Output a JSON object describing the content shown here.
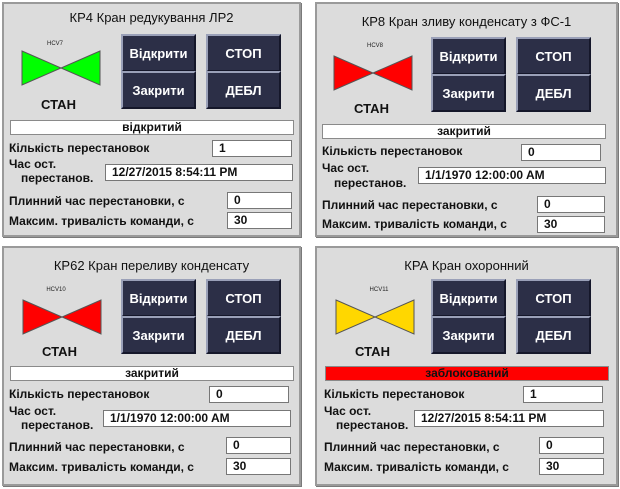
{
  "panels": [
    {
      "title": "КР4 Кран редукування ЛР2",
      "tag": "HCV7",
      "valve_color": "#00ff00",
      "state_label": "СТАН",
      "open_label": "Відкрити",
      "close_label": "Закрити",
      "stop_label": "СТОП",
      "deblock_label": "ДЕБЛ",
      "status": "відкритий",
      "status_color": "#ffffff",
      "count_label": "Кількість перестановок",
      "count": "1",
      "time_label_1": "Час ост.",
      "time_label_2": "перестанов.",
      "time": "12/27/2015 8:54:11 PM",
      "move_time_label": "Плинний час перестановки,  с",
      "move_time": "0",
      "max_time_label": "Максим. тривалість команди, с",
      "max_time": "30"
    },
    {
      "title": "КР8 Кран зливу конденсату з ФС-1",
      "tag": "HCV8",
      "valve_color": "#ff0000",
      "state_label": "СТАН",
      "open_label": "Відкрити",
      "close_label": "Закрити",
      "stop_label": "СТОП",
      "deblock_label": "ДЕБЛ",
      "status": "закритий",
      "status_color": "#ffffff",
      "count_label": "Кількість перестановок",
      "count": "0",
      "time_label_1": "Час ост.",
      "time_label_2": "перестанов.",
      "time": "1/1/1970 12:00:00 AM",
      "move_time_label": "Плинний час перестановки,  с",
      "move_time": "0",
      "max_time_label": "Максим. тривалість команди, с",
      "max_time": "30"
    },
    {
      "title": "КР62 Кран переливу конденсату",
      "tag": "HCV10",
      "valve_color": "#ff0000",
      "state_label": "СТАН",
      "open_label": "Відкрити",
      "close_label": "Закрити",
      "stop_label": "СТОП",
      "deblock_label": "ДЕБЛ",
      "status": "закритий",
      "status_color": "#ffffff",
      "count_label": "Кількість перестановок",
      "count": "0",
      "time_label_1": "Час ост.",
      "time_label_2": "перестанов.",
      "time": "1/1/1970 12:00:00 AM",
      "move_time_label": "Плинний час перестановки,  с",
      "move_time": "0",
      "max_time_label": "Максим. тривалість команди, с",
      "max_time": "30"
    },
    {
      "title": "КРА Кран охоронний",
      "tag": "HCV11",
      "valve_color": "#ffd700",
      "state_label": "СТАН",
      "open_label": "Відкрити",
      "close_label": "Закрити",
      "stop_label": "СТОП",
      "deblock_label": "ДЕБЛ",
      "status": "заблокований",
      "status_color": "#ff0000",
      "count_label": "Кількість перестановок",
      "count": "1",
      "time_label_1": "Час ост.",
      "time_label_2": "перестанов.",
      "time": "12/27/2015 8:54:11 PM",
      "move_time_label": "Плинний час перестановки,  с",
      "move_time": "0",
      "max_time_label": "Максим. тривалість команди, с",
      "max_time": "30"
    }
  ]
}
